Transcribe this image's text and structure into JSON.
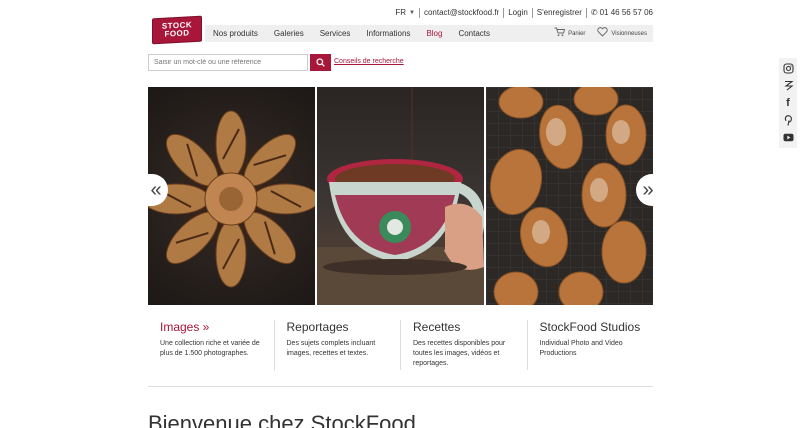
{
  "topbar": {
    "lang": "FR",
    "email": "contact@stockfood.fr",
    "login": "Login",
    "register": "S'enregistrer",
    "phone": "01 46 56 57 06"
  },
  "logo": {
    "line1": "STOCK",
    "line2": "FOOD"
  },
  "nav": {
    "items": [
      "Nos produits",
      "Galeries",
      "Services",
      "Informations",
      "Blog",
      "Contacts"
    ],
    "cart": "Panier",
    "lightbox": "Visionneuses"
  },
  "search": {
    "placeholder": "Saisir un mot-clé ou une référence",
    "help": "Conseils de recherche"
  },
  "hero": {
    "arrow_left": "«",
    "arrow_right": "»"
  },
  "categories": [
    {
      "title": "Images »",
      "desc": "Une collection riche et variée de plus de 1.500 photographes."
    },
    {
      "title": "Reportages",
      "desc": "Des sujets complets incluant images, recettes et textes."
    },
    {
      "title": "Recettes",
      "desc": "Des recettes disponibles pour toutes les images, vidéos et reportages."
    },
    {
      "title": "StockFood Studios",
      "desc": "Individual Photo and Video Productions"
    }
  ],
  "welcome": {
    "prefix": "Bienvenue chez ",
    "brand": "StockFood"
  },
  "social": [
    "instagram-icon",
    "behance-icon",
    "facebook-icon",
    "pinterest-icon",
    "youtube-icon"
  ],
  "colors": {
    "accent": "#a8163a",
    "nav_bg": "#efefef"
  }
}
